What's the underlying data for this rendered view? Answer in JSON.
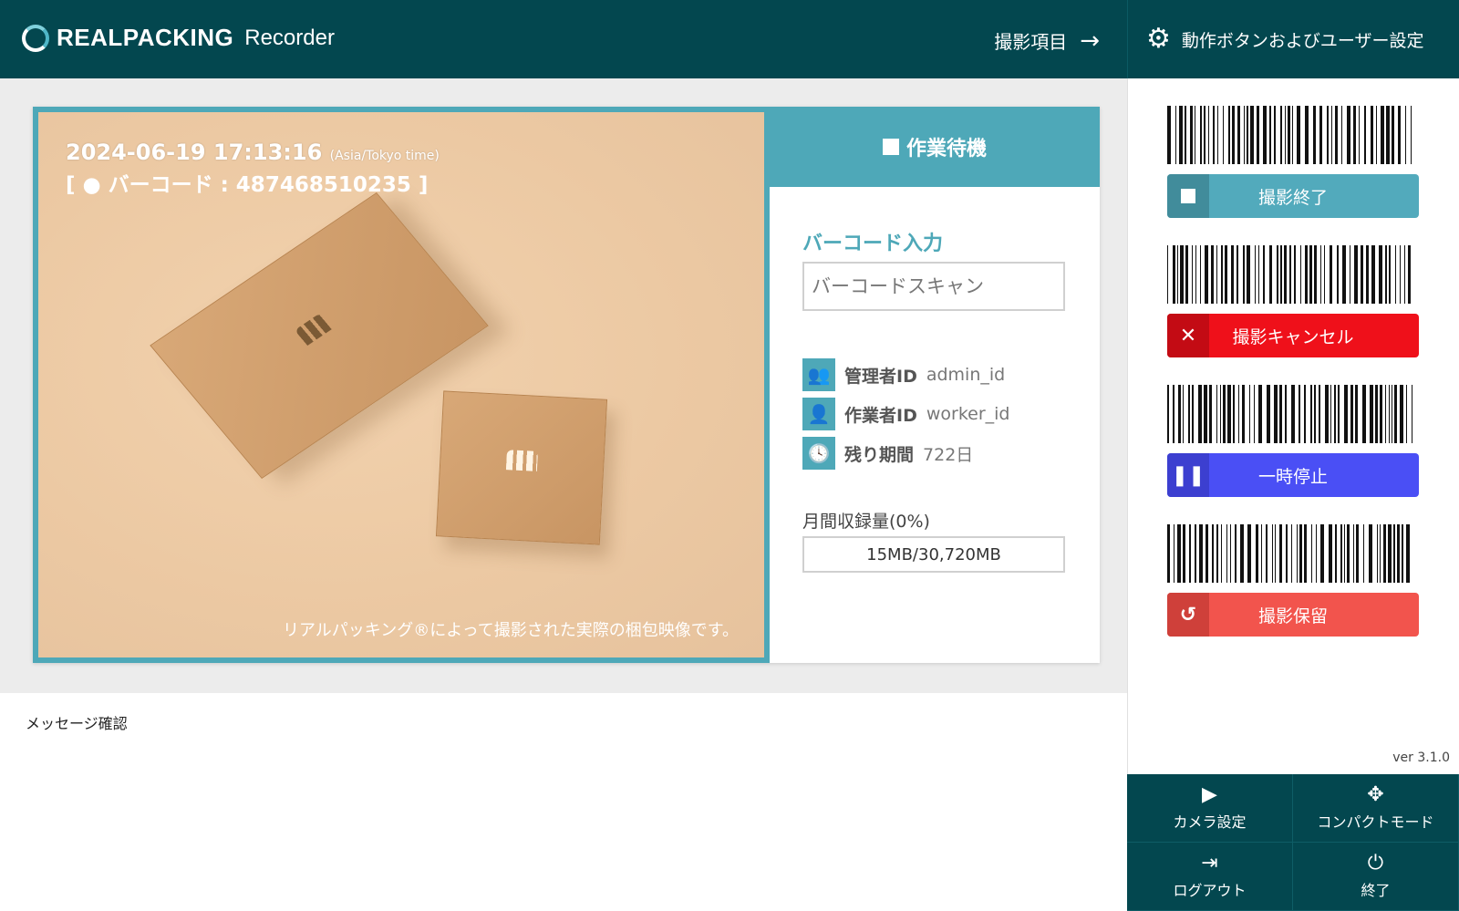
{
  "header": {
    "brand": "REALPACKING",
    "product": "Recorder",
    "nav_label": "撮影項目",
    "nav_arrow": "→",
    "settings_label": "動作ボタンおよびユーザー設定"
  },
  "video": {
    "timestamp": "2024-06-19 17:13:16",
    "timezone": "(Asia/Tokyo time)",
    "barcode_line": "[ ● バーコード : 487468510235 ]",
    "caption": "リアルパッキング®によって撮影された実際の梱包映像です。"
  },
  "status": {
    "title": "作業待機"
  },
  "barcode_input": {
    "title": "バーコード入力",
    "placeholder": "バーコードスキャン"
  },
  "info": [
    {
      "label": "管理者ID",
      "value": "admin_id",
      "icon": "users-icon"
    },
    {
      "label": "作業者ID",
      "value": "worker_id",
      "icon": "user-icon"
    },
    {
      "label": "残り期間",
      "value": "722日",
      "icon": "clock-icon"
    }
  ],
  "usage": {
    "label": "月間収録量(0%)",
    "value": "15MB/30,720MB",
    "percent": 0
  },
  "message": "メッセージ確認",
  "actions": [
    {
      "label": "撮影終了",
      "icon": "stop-icon",
      "color": "#52aabc"
    },
    {
      "label": "撮影キャンセル",
      "icon": "close-icon",
      "color": "#ef101a"
    },
    {
      "label": "一時停止",
      "icon": "pause-icon",
      "color": "#4a4ff5"
    },
    {
      "label": "撮影保留",
      "icon": "history-icon",
      "color": "#f2544d"
    }
  ],
  "version": "ver 3.1.0",
  "footer": {
    "camera": "カメラ設定",
    "compact": "コンパクトモード",
    "logout": "ログアウト",
    "exit": "終了"
  },
  "colors": {
    "header_bg": "#03474f",
    "accent": "#4ea8b8"
  }
}
